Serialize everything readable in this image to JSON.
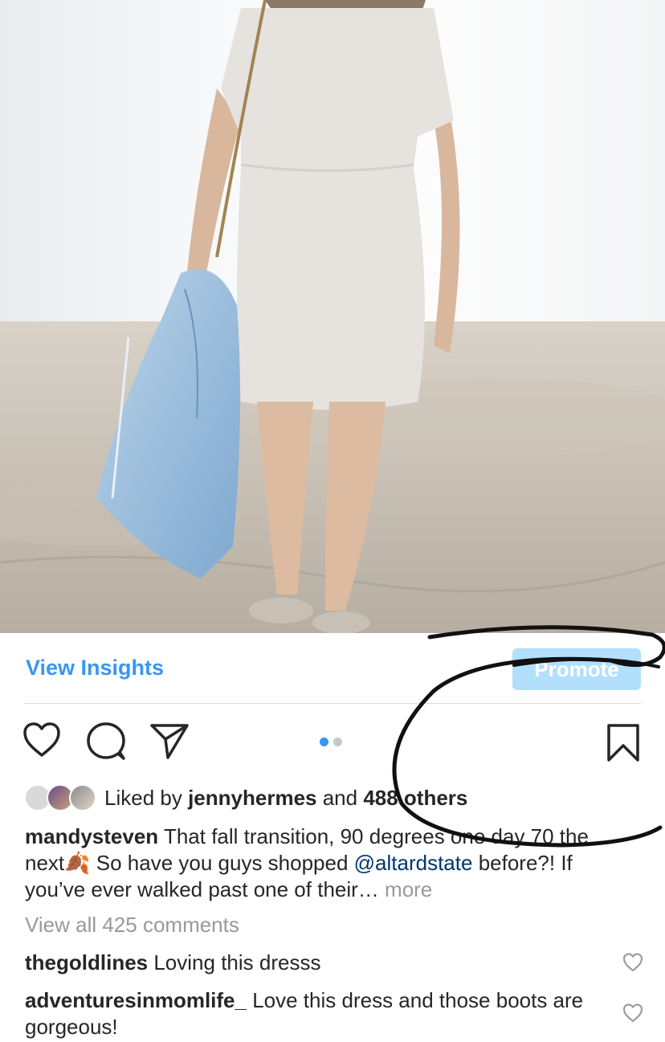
{
  "post": {
    "insights_label": "View Insights",
    "promote_label": "Promote",
    "carousel": {
      "total": 2,
      "active": 1
    }
  },
  "likes": {
    "prefix": "Liked by ",
    "user": "jennyhermes",
    "and": " and ",
    "others": "488 others"
  },
  "caption": {
    "username": "mandysteven",
    "text1": " That fall transition, 90 degrees one day 70 the next",
    "emoji": "🍂",
    "text2": " So have you guys shopped ",
    "mention": "@altardstate",
    "text3": " before?! If you’ve ever walked past one of their… ",
    "more": "more"
  },
  "comments": {
    "view_all": "View all 425 comments",
    "items": [
      {
        "username": "thegoldlines",
        "text": " Loving this dresss"
      },
      {
        "username": "adventuresinmomlife_",
        "text": " Love this dress and those boots are gorgeous!"
      }
    ]
  },
  "colors": {
    "accent": "#3897f0",
    "promote_bg": "#b2dffc",
    "mention": "#003569",
    "muted": "#999999",
    "annotation_ink": "#111111"
  },
  "icons": [
    "heart-icon",
    "comment-icon",
    "share-icon",
    "bookmark-icon"
  ]
}
